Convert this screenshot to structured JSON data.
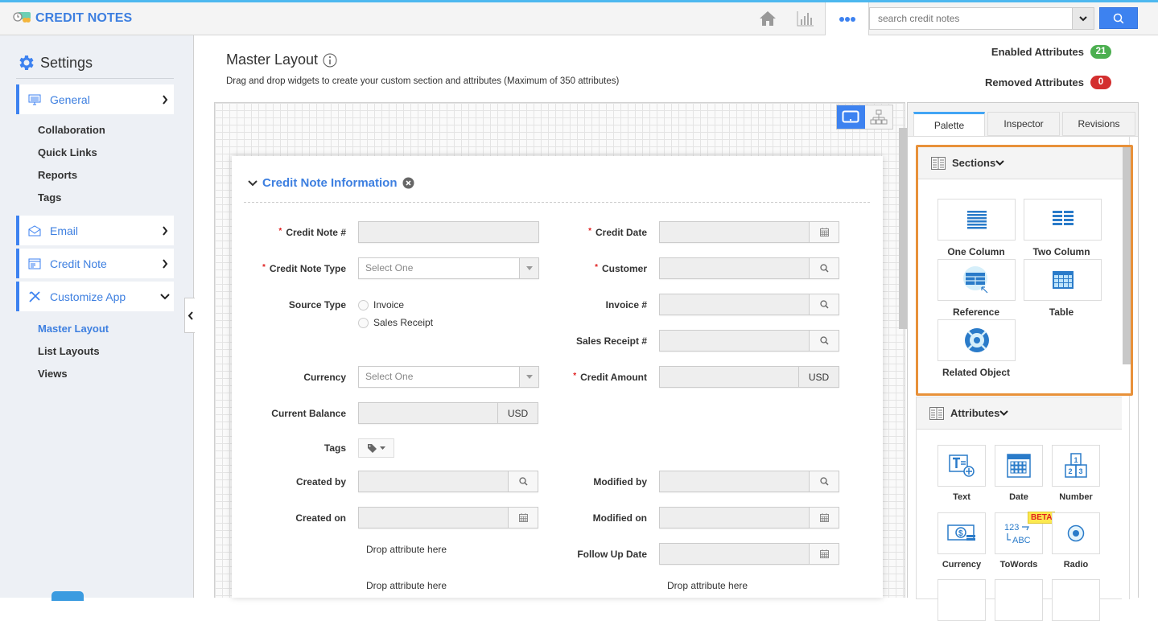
{
  "app": {
    "title": "CREDIT NOTES"
  },
  "header": {
    "icons": [
      "home-icon",
      "chart-icon",
      "more-icon"
    ],
    "search": {
      "placeholder": "search credit notes",
      "value": ""
    }
  },
  "sidebar": {
    "title": "Settings",
    "groups": [
      {
        "label": "General",
        "icon": "monitor-icon",
        "expanded": false,
        "children": [
          "Collaboration",
          "Quick Links",
          "Reports",
          "Tags"
        ]
      },
      {
        "label": "Email",
        "icon": "envelope-icon",
        "expanded": false
      },
      {
        "label": "Credit Note",
        "icon": "form-icon",
        "expanded": false
      },
      {
        "label": "Customize App",
        "icon": "tools-icon",
        "expanded": true,
        "children": [
          "Master Layout",
          "List Layouts",
          "Views"
        ],
        "active_child": "Master Layout"
      }
    ]
  },
  "main": {
    "title": "Master Layout",
    "description": "Drag and drop widgets to create your custom section and attributes (Maximum of 350 attributes)",
    "enabled_label": "Enabled Attributes",
    "enabled_count": "21",
    "removed_label": "Removed Attributes",
    "removed_count": "0",
    "colors": {
      "enabled": "#4caf50",
      "removed": "#d32f2f",
      "accent": "#3d7fe0",
      "highlight": "#e8913a"
    }
  },
  "section": {
    "title": "Credit Note Information",
    "fields": {
      "credit_note_no": {
        "label": "Credit Note #",
        "required": true
      },
      "credit_note_type": {
        "label": "Credit Note Type",
        "required": true,
        "placeholder": "Select One"
      },
      "source_type": {
        "label": "Source Type",
        "options": [
          "Invoice",
          "Sales Receipt"
        ]
      },
      "currency": {
        "label": "Currency",
        "placeholder": "Select One"
      },
      "current_balance": {
        "label": "Current Balance",
        "unit": "USD"
      },
      "tags": {
        "label": "Tags"
      },
      "created_by": {
        "label": "Created by"
      },
      "created_on": {
        "label": "Created on"
      },
      "credit_date": {
        "label": "Credit Date",
        "required": true
      },
      "customer": {
        "label": "Customer",
        "required": true
      },
      "invoice_no": {
        "label": "Invoice #"
      },
      "sales_receipt_no": {
        "label": "Sales Receipt #"
      },
      "credit_amount": {
        "label": "Credit Amount",
        "required": true,
        "unit": "USD"
      },
      "modified_by": {
        "label": "Modified by"
      },
      "modified_on": {
        "label": "Modified on"
      },
      "follow_up_date": {
        "label": "Follow Up Date"
      }
    },
    "drop_placeholder": "Drop attribute here",
    "required_mark": "*"
  },
  "palette": {
    "tabs": [
      "Palette",
      "Inspector",
      "Revisions"
    ],
    "active_tab": "Palette",
    "sections_title": "Sections",
    "sections": [
      "One Column",
      "Two Column",
      "Reference",
      "Table",
      "Related Object"
    ],
    "attributes_title": "Attributes",
    "attributes": [
      "Text",
      "Date",
      "Number",
      "Currency",
      "ToWords",
      "Radio"
    ],
    "beta_label": "BETA"
  }
}
